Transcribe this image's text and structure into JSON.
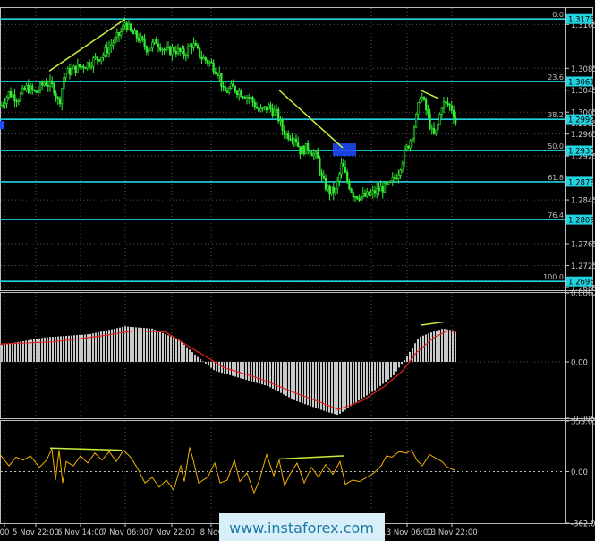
{
  "colors": {
    "background": "#000000",
    "candle": "#33ee33",
    "fib_line": "#22d3e0",
    "trend_line": "#c8f03a",
    "axis_text": "#cccccc",
    "axis_label_bg": "#000000",
    "fib_price_bg": "#22d3e0",
    "fib_price_text": "#000000",
    "macd_hist": "#c8c8c8",
    "macd_signal": "#e22222",
    "osc_line": "#f0b000",
    "osc_zero": "#bbbbbb",
    "highlight_box": "#1e4cff",
    "watermark_bg": "#d8eef8",
    "watermark_text": "#1a7aa6"
  },
  "watermark": "www.instaforex.com",
  "chart_data": [
    {
      "type": "candlestick",
      "panel": "price",
      "ylim": [
        1.268,
        1.3195
      ],
      "price_ticks": [
        "1.3165",
        "1.3085",
        "1.3045",
        "1.3005",
        "1.2965",
        "1.2925",
        "1.2845",
        "1.2765",
        "1.2725",
        "1.2685"
      ],
      "fib_levels": [
        {
          "label": "0.0",
          "price": 1.3175,
          "price_label": "1.3175"
        },
        {
          "label": "23.6",
          "price": 1.3061,
          "price_label": "1.3061"
        },
        {
          "label": "38.2",
          "price": 1.2992,
          "price_label": "1.2992"
        },
        {
          "label": "50.0",
          "price": 1.2935,
          "price_label": "1.2935"
        },
        {
          "label": "61.8",
          "price": 1.2878,
          "price_label": "1.2878"
        },
        {
          "label": "76.4",
          "price": 1.2809,
          "price_label": "1.2809"
        },
        {
          "label": "100.0",
          "price": 1.2696,
          "price_label": "1.2696"
        }
      ],
      "hidden_tick": "1.2985",
      "close_points": [
        [
          0,
          1.3015
        ],
        [
          10,
          1.304
        ],
        [
          20,
          1.303
        ],
        [
          30,
          1.305
        ],
        [
          40,
          1.304
        ],
        [
          50,
          1.306
        ],
        [
          60,
          1.305
        ],
        [
          66,
          1.302
        ],
        [
          72,
          1.3075
        ],
        [
          85,
          1.3085
        ],
        [
          100,
          1.3095
        ],
        [
          115,
          1.311
        ],
        [
          125,
          1.313
        ],
        [
          135,
          1.315
        ],
        [
          140,
          1.317
        ],
        [
          146,
          1.315
        ],
        [
          155,
          1.314
        ],
        [
          165,
          1.312
        ],
        [
          175,
          1.3135
        ],
        [
          185,
          1.3115
        ],
        [
          195,
          1.312
        ],
        [
          205,
          1.311
        ],
        [
          215,
          1.313
        ],
        [
          225,
          1.3105
        ],
        [
          235,
          1.3095
        ],
        [
          245,
          1.3075
        ],
        [
          250,
          1.304
        ],
        [
          260,
          1.305
        ],
        [
          270,
          1.304
        ],
        [
          280,
          1.303
        ],
        [
          290,
          1.3005
        ],
        [
          300,
          1.3015
        ],
        [
          310,
          1.3
        ],
        [
          315,
          1.2975
        ],
        [
          320,
          1.2965
        ],
        [
          330,
          1.296
        ],
        [
          335,
          1.2935
        ],
        [
          345,
          1.294
        ],
        [
          355,
          1.292
        ],
        [
          360,
          1.288
        ],
        [
          368,
          1.286
        ],
        [
          375,
          1.286
        ],
        [
          382,
          1.291
        ],
        [
          388,
          1.288
        ],
        [
          395,
          1.2855
        ],
        [
          405,
          1.285
        ],
        [
          415,
          1.2855
        ],
        [
          425,
          1.2865
        ],
        [
          435,
          1.287
        ],
        [
          445,
          1.2895
        ],
        [
          452,
          1.293
        ],
        [
          460,
          1.296
        ],
        [
          466,
          1.3
        ],
        [
          470,
          1.304
        ],
        [
          478,
          1.3
        ],
        [
          484,
          1.296
        ],
        [
          488,
          1.297
        ],
        [
          494,
          1.302
        ],
        [
          500,
          1.302
        ],
        [
          506,
          1.301
        ],
        [
          510,
          1.298
        ]
      ],
      "trend_lines": [
        {
          "from": [
            55,
            1.308
          ],
          "to": [
            140,
            1.3175
          ]
        },
        {
          "from": [
            312,
            1.3045
          ],
          "to": [
            383,
            1.294
          ]
        },
        {
          "from": [
            470,
            1.3045
          ],
          "to": [
            490,
            1.303
          ]
        }
      ],
      "highlight_zone": {
        "x_from": 372,
        "x_to": 398,
        "price_from": 1.2948,
        "price_to": 1.2925
      }
    },
    {
      "type": "bar",
      "panel": "macd",
      "ylim": [
        -0.00509,
        0.00622
      ],
      "tick_labels": [
        "0.00622",
        "0.00",
        "-0.00509"
      ],
      "histogram_points": [
        [
          0,
          0.0015
        ],
        [
          50,
          0.0022
        ],
        [
          100,
          0.0025
        ],
        [
          140,
          0.0032
        ],
        [
          170,
          0.003
        ],
        [
          200,
          0.002
        ],
        [
          220,
          0.0005
        ],
        [
          240,
          -0.0008
        ],
        [
          270,
          -0.0015
        ],
        [
          300,
          -0.0022
        ],
        [
          330,
          -0.0035
        ],
        [
          365,
          -0.0045
        ],
        [
          378,
          -0.0048
        ],
        [
          395,
          -0.0038
        ],
        [
          420,
          -0.0025
        ],
        [
          440,
          -0.0012
        ],
        [
          455,
          0.0005
        ],
        [
          468,
          0.0022
        ],
        [
          480,
          0.0026
        ],
        [
          495,
          0.003
        ],
        [
          510,
          0.0028
        ]
      ],
      "signal_points": [
        [
          0,
          0.0016
        ],
        [
          60,
          0.0018
        ],
        [
          110,
          0.0023
        ],
        [
          150,
          0.0028
        ],
        [
          185,
          0.0027
        ],
        [
          215,
          0.0012
        ],
        [
          250,
          -0.0005
        ],
        [
          290,
          -0.0015
        ],
        [
          330,
          -0.0028
        ],
        [
          360,
          -0.0037
        ],
        [
          378,
          -0.0043
        ],
        [
          405,
          -0.0035
        ],
        [
          430,
          -0.0022
        ],
        [
          450,
          -0.0008
        ],
        [
          465,
          0.0008
        ],
        [
          485,
          0.0022
        ],
        [
          500,
          0.0028
        ],
        [
          510,
          0.0027
        ]
      ],
      "trend_line": {
        "from": [
          470,
          0.0033
        ],
        "to": [
          496,
          0.0036
        ]
      }
    },
    {
      "type": "line",
      "panel": "oscillator",
      "ylim": [
        -362.0658,
        355.0508
      ],
      "tick_labels": [
        "355.0508",
        "0.00",
        "-362.0658"
      ],
      "points": [
        [
          0,
          120
        ],
        [
          10,
          40
        ],
        [
          18,
          100
        ],
        [
          26,
          80
        ],
        [
          34,
          110
        ],
        [
          44,
          30
        ],
        [
          52,
          80
        ],
        [
          58,
          160
        ],
        [
          62,
          -60
        ],
        [
          66,
          150
        ],
        [
          70,
          -80
        ],
        [
          74,
          70
        ],
        [
          82,
          40
        ],
        [
          90,
          110
        ],
        [
          98,
          60
        ],
        [
          106,
          130
        ],
        [
          114,
          80
        ],
        [
          122,
          140
        ],
        [
          130,
          70
        ],
        [
          138,
          150
        ],
        [
          146,
          100
        ],
        [
          154,
          20
        ],
        [
          162,
          -80
        ],
        [
          170,
          -40
        ],
        [
          178,
          -110
        ],
        [
          186,
          -60
        ],
        [
          194,
          -130
        ],
        [
          202,
          40
        ],
        [
          206,
          -70
        ],
        [
          212,
          170
        ],
        [
          216,
          80
        ],
        [
          222,
          -80
        ],
        [
          232,
          -40
        ],
        [
          240,
          60
        ],
        [
          246,
          -80
        ],
        [
          254,
          -60
        ],
        [
          262,
          80
        ],
        [
          268,
          -70
        ],
        [
          276,
          -10
        ],
        [
          284,
          -150
        ],
        [
          290,
          -60
        ],
        [
          298,
          120
        ],
        [
          306,
          -30
        ],
        [
          312,
          80
        ],
        [
          318,
          -100
        ],
        [
          324,
          -20
        ],
        [
          332,
          60
        ],
        [
          340,
          -80
        ],
        [
          348,
          30
        ],
        [
          356,
          -40
        ],
        [
          364,
          50
        ],
        [
          372,
          -20
        ],
        [
          380,
          70
        ],
        [
          386,
          -90
        ],
        [
          394,
          -60
        ],
        [
          402,
          -70
        ],
        [
          410,
          -40
        ],
        [
          418,
          -10
        ],
        [
          426,
          40
        ],
        [
          432,
          110
        ],
        [
          438,
          100
        ],
        [
          446,
          140
        ],
        [
          454,
          130
        ],
        [
          460,
          150
        ],
        [
          466,
          80
        ],
        [
          472,
          40
        ],
        [
          480,
          120
        ],
        [
          488,
          90
        ],
        [
          494,
          70
        ],
        [
          500,
          30
        ],
        [
          508,
          10
        ]
      ],
      "trend_lines": [
        {
          "from": [
            56,
            165
          ],
          "to": [
            136,
            150
          ]
        },
        {
          "from": [
            312,
            88
          ],
          "to": [
            384,
            110
          ]
        }
      ]
    }
  ],
  "time_labels": [
    {
      "x": 5,
      "label": "00"
    },
    {
      "x": 40,
      "label": "5 Nov 22:00"
    },
    {
      "x": 90,
      "label": "6 Nov 14:00"
    },
    {
      "x": 140,
      "label": "7 Nov 06:00"
    },
    {
      "x": 192,
      "label": "7 Nov 22:00"
    },
    {
      "x": 236,
      "label": "8 Nov"
    },
    {
      "x": 415,
      "label": "00"
    },
    {
      "x": 455,
      "label": "13 Nov 06:00"
    },
    {
      "x": 505,
      "label": "13 Nov 22:00"
    }
  ]
}
